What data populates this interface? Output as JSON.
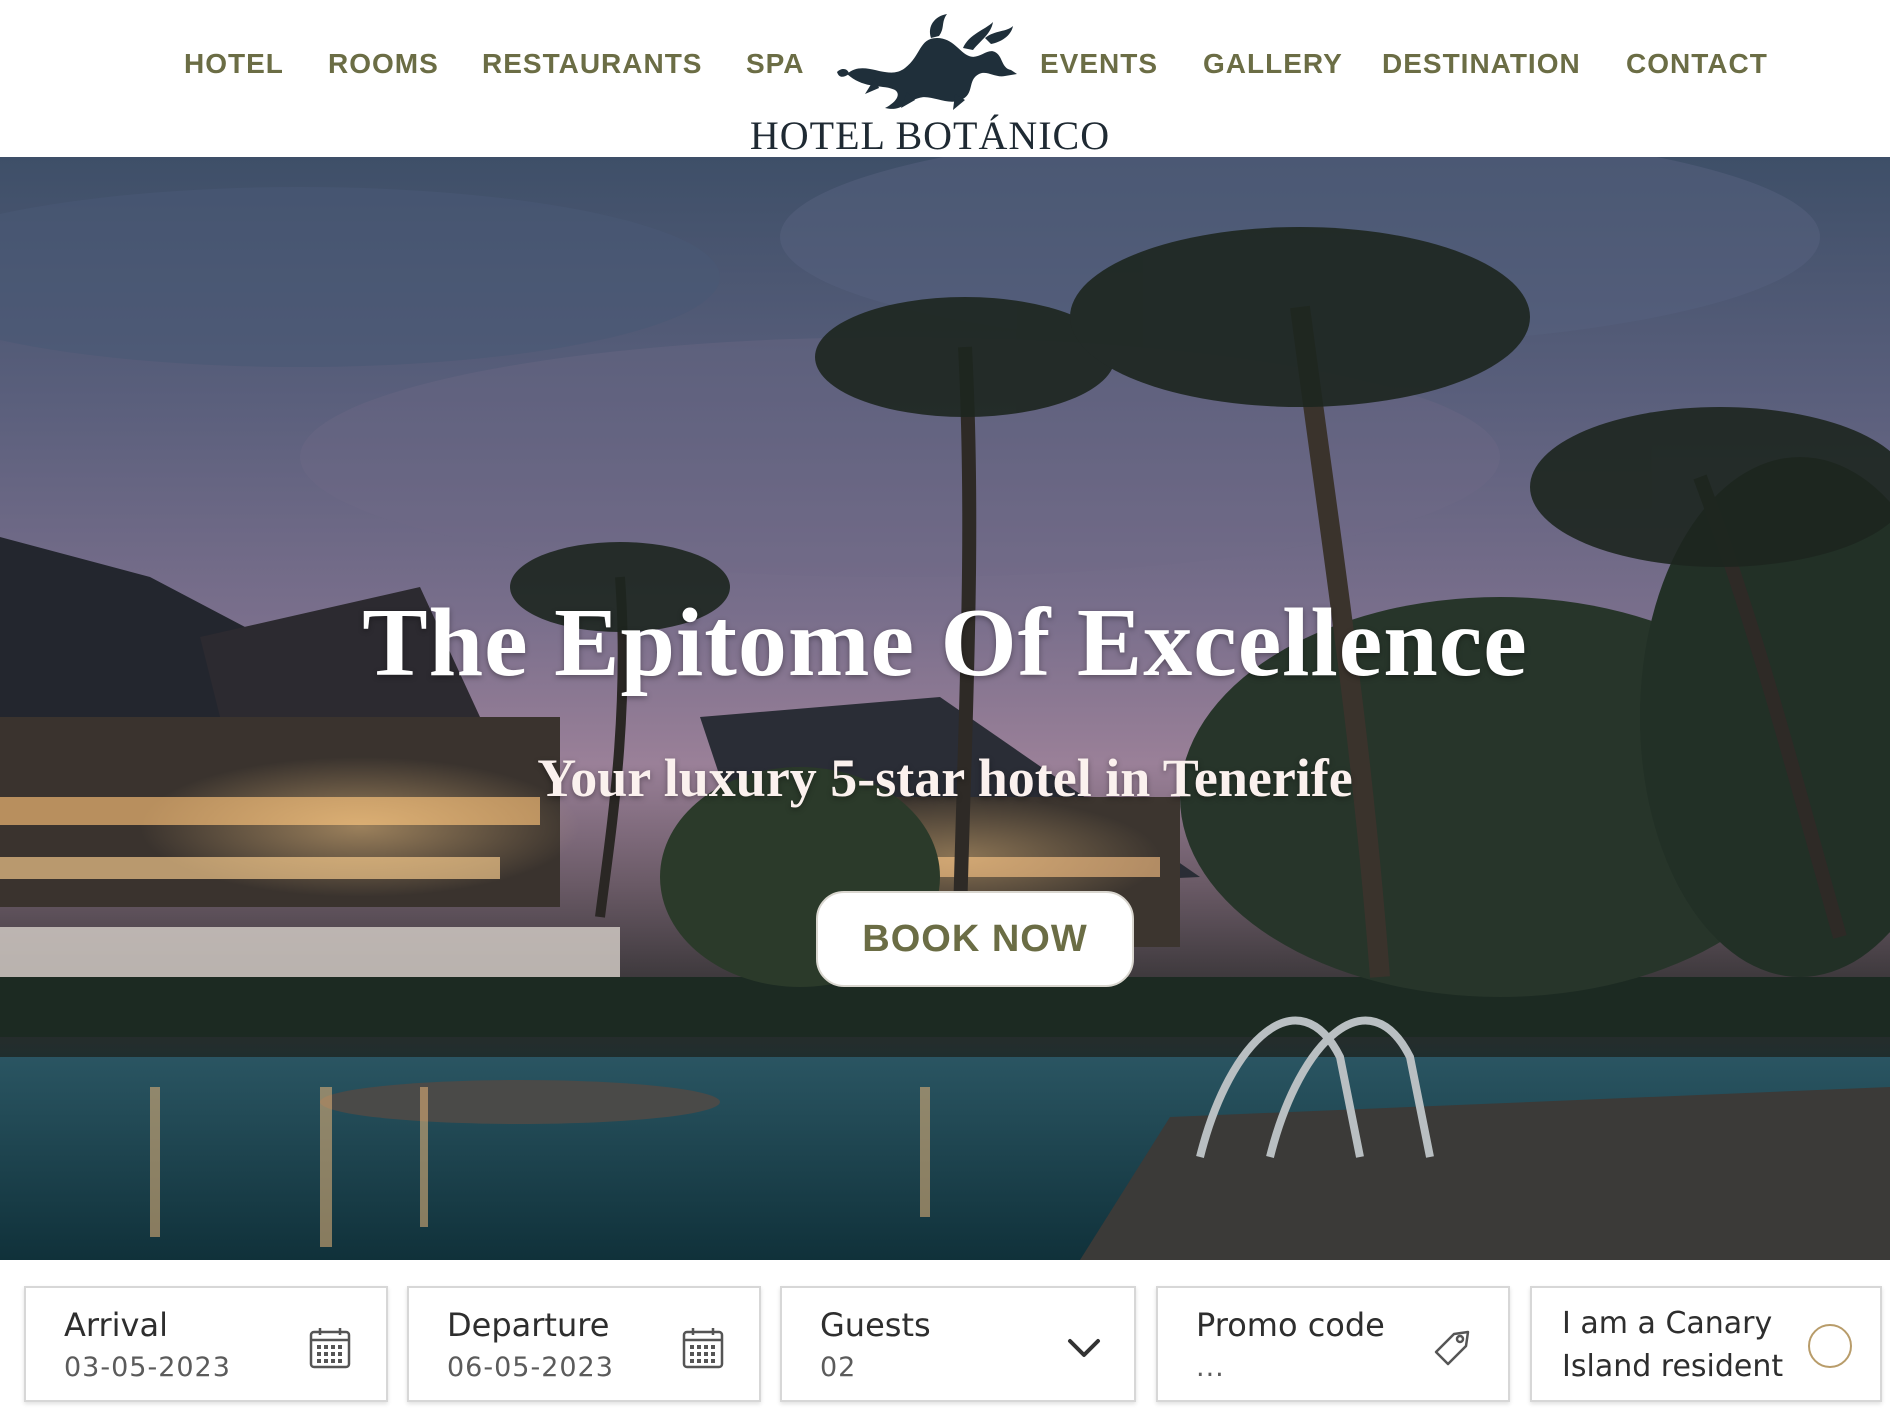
{
  "nav": {
    "left": [
      "HOTEL",
      "ROOMS",
      "RESTAURANTS",
      "SPA"
    ],
    "right": [
      "EVENTS",
      "GALLERY",
      "DESTINATION",
      "CONTACT"
    ]
  },
  "logo": {
    "text": "HOTEL BOTÁNICO",
    "icon": "dragon-icon"
  },
  "hero": {
    "title": "The Epitome Of Excellence",
    "subtitle": "Your luxury 5-star hotel in Tenerife",
    "cta_label": "BOOK NOW"
  },
  "booking": {
    "arrival": {
      "label": "Arrival",
      "value": "03-05-2023",
      "icon": "calendar-icon"
    },
    "departure": {
      "label": "Departure",
      "value": "06-05-2023",
      "icon": "calendar-icon"
    },
    "guests": {
      "label": "Guests",
      "value": "02",
      "icon": "chevron-down-icon"
    },
    "promo": {
      "label": "Promo code",
      "value": "...",
      "icon": "tag-icon"
    },
    "resident": {
      "label": "I am a Canary Island resident",
      "checked": false
    }
  },
  "colors": {
    "nav_text": "#6b6d45",
    "logo_text": "#1f2a33",
    "radio_border": "#b89c6a"
  }
}
